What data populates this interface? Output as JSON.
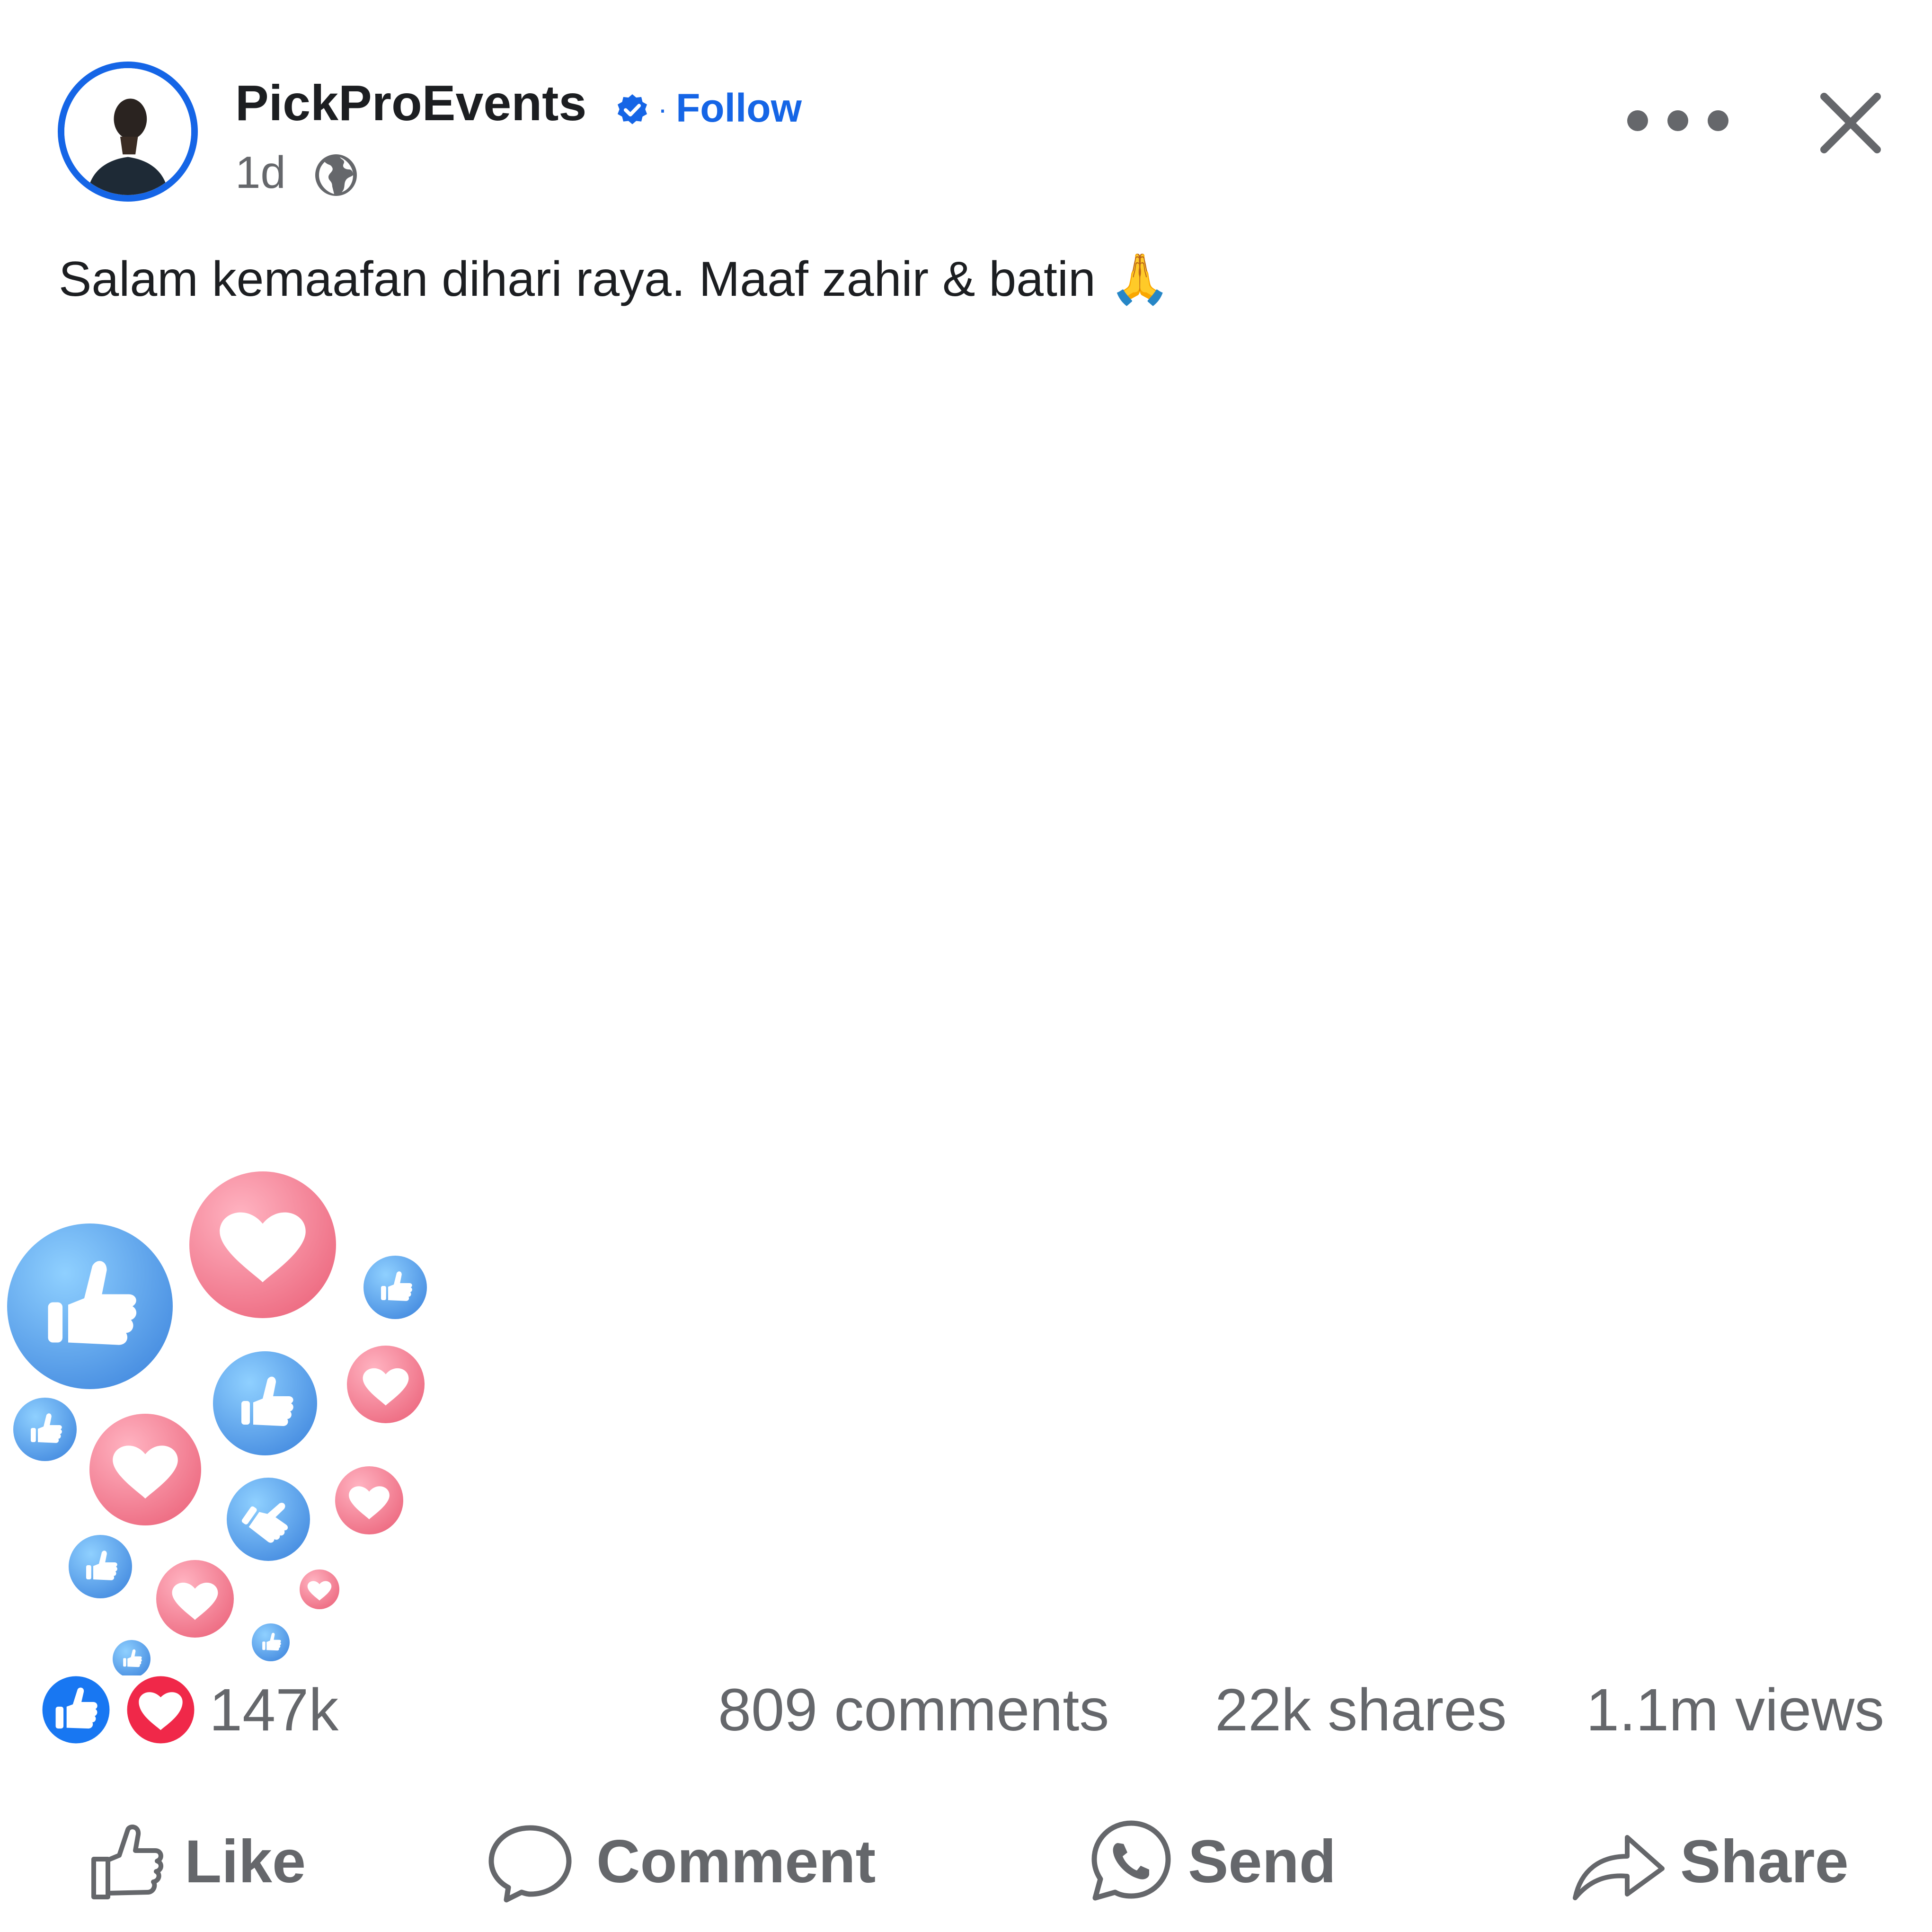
{
  "colors": {
    "brand_blue": "#1565e6",
    "text_primary": "#1c1e21",
    "text_secondary": "#65676b",
    "like_blue": "#1877f2",
    "love_red": "#f02849"
  },
  "header": {
    "page_name": "PickProEvents",
    "verified_icon": "verified-badge-icon",
    "follow_label": "Follow",
    "separator": "·",
    "time": "1d",
    "audience_icon": "globe-icon",
    "more_icon": "more-dots-icon",
    "close_icon": "close-icon"
  },
  "post": {
    "text": "Salam kemaafan dihari raya. Maaf zahir & batin 🙏"
  },
  "stats": {
    "reaction_icons": [
      "like-reaction-icon",
      "love-reaction-icon"
    ],
    "reaction_count": "147k",
    "comments": "809 comments",
    "shares": "22k shares",
    "views": "1.1m views"
  },
  "actions": {
    "like": "Like",
    "comment": "Comment",
    "send": "Send",
    "share": "Share"
  }
}
